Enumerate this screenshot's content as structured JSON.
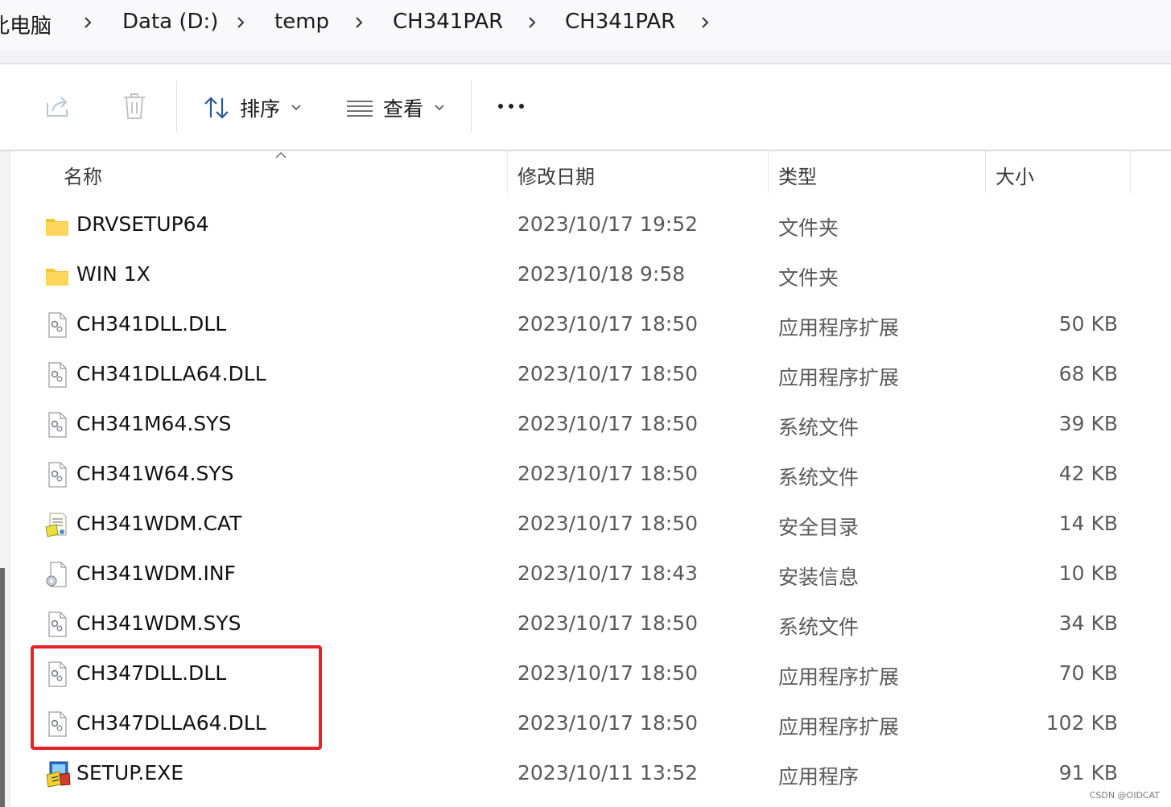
{
  "breadcrumb": [
    "此电脑",
    "Data (D:)",
    "temp",
    "CH341PAR",
    "CH341PAR"
  ],
  "toolbar": {
    "sort_label": "排序",
    "view_label": "查看"
  },
  "columns": {
    "name": "名称",
    "date": "修改日期",
    "type": "类型",
    "size": "大小"
  },
  "files": [
    {
      "name": "DRVSETUP64",
      "date": "2023/10/17 19:52",
      "type": "文件夹",
      "size": "",
      "icon": "folder-icon"
    },
    {
      "name": "WIN 1X",
      "date": "2023/10/18 9:58",
      "type": "文件夹",
      "size": "",
      "icon": "folder-icon"
    },
    {
      "name": "CH341DLL.DLL",
      "date": "2023/10/17 18:50",
      "type": "应用程序扩展",
      "size": "50 KB",
      "icon": "dll-file-icon"
    },
    {
      "name": "CH341DLLA64.DLL",
      "date": "2023/10/17 18:50",
      "type": "应用程序扩展",
      "size": "68 KB",
      "icon": "dll-file-icon"
    },
    {
      "name": "CH341M64.SYS",
      "date": "2023/10/17 18:50",
      "type": "系统文件",
      "size": "39 KB",
      "icon": "sys-file-icon"
    },
    {
      "name": "CH341W64.SYS",
      "date": "2023/10/17 18:50",
      "type": "系统文件",
      "size": "42 KB",
      "icon": "sys-file-icon"
    },
    {
      "name": "CH341WDM.CAT",
      "date": "2023/10/17 18:50",
      "type": "安全目录",
      "size": "14 KB",
      "icon": "catalog-file-icon"
    },
    {
      "name": "CH341WDM.INF",
      "date": "2023/10/17 18:43",
      "type": "安装信息",
      "size": "10 KB",
      "icon": "inf-file-icon"
    },
    {
      "name": "CH341WDM.SYS",
      "date": "2023/10/17 18:50",
      "type": "系统文件",
      "size": "34 KB",
      "icon": "sys-file-icon"
    },
    {
      "name": "CH347DLL.DLL",
      "date": "2023/10/17 18:50",
      "type": "应用程序扩展",
      "size": "70 KB",
      "icon": "dll-file-icon"
    },
    {
      "name": "CH347DLLA64.DLL",
      "date": "2023/10/17 18:50",
      "type": "应用程序扩展",
      "size": "102 KB",
      "icon": "dll-file-icon"
    },
    {
      "name": "SETUP.EXE",
      "date": "2023/10/11 13:52",
      "type": "应用程序",
      "size": "91 KB",
      "icon": "exe-setup-icon"
    }
  ],
  "highlight_color": "#e8202a",
  "watermark": "CSDN @OIDCAT"
}
